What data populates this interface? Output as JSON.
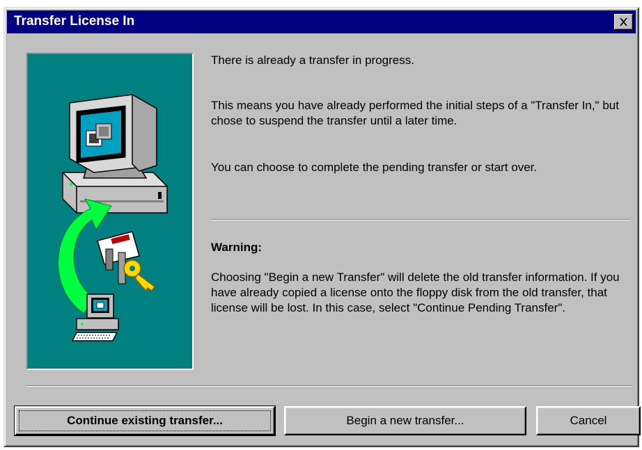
{
  "window": {
    "title": "Transfer License In",
    "close_icon": "close-icon"
  },
  "content": {
    "status": "There is already a transfer in progress.",
    "explanation": "This means you have already performed the initial steps of a \"Transfer In,\" but chose to suspend the transfer until a later time.",
    "choice": "You can choose to complete the pending transfer or start over.",
    "warning_heading": "Warning:",
    "warning_text": "Choosing \"Begin a new Transfer\" will delete the old transfer information. If you have already copied a license onto the floppy disk from the old transfer, that license will be lost. In this case, select \"Continue Pending Transfer\"."
  },
  "illustration": {
    "icons": [
      "computer-icon",
      "transfer-arrow-icon",
      "keys-icon",
      "small-computer-icon"
    ],
    "background_color": "#008080"
  },
  "buttons": {
    "continue": "Continue existing transfer...",
    "begin": "Begin a new transfer...",
    "cancel": "Cancel"
  },
  "colors": {
    "titlebar": "#000080",
    "dialog_face": "#c0c0c0",
    "arrow": "#00ff40"
  }
}
